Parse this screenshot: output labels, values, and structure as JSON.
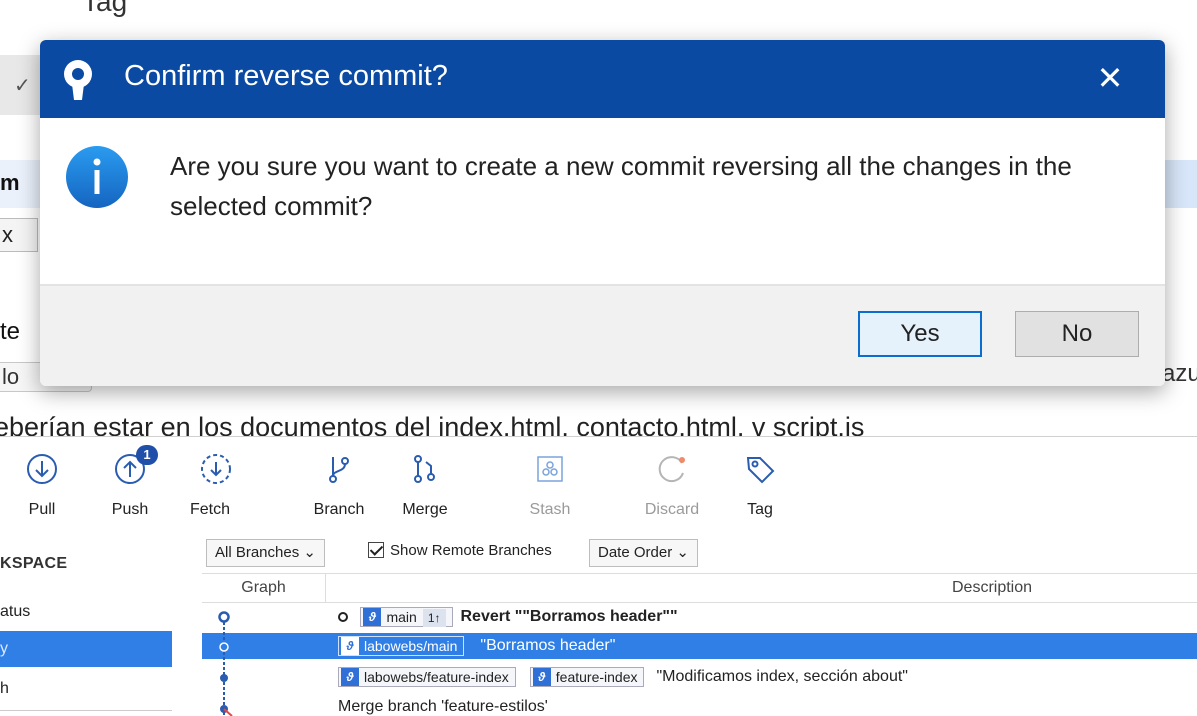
{
  "background": {
    "top_tag": "Tag",
    "left_fragments": [
      "m",
      "x",
      "te",
      "lo"
    ],
    "right_fragment": "azu",
    "desc_line": "eberían estar en los documentos del index.html. contacto.html. v script.is"
  },
  "toolbar": {
    "buttons": [
      {
        "label": "Pull",
        "icon": "pull-icon",
        "disabled": false
      },
      {
        "label": "Push",
        "icon": "push-icon",
        "disabled": false,
        "badge": "1"
      },
      {
        "label": "Fetch",
        "icon": "fetch-icon",
        "disabled": false
      },
      {
        "label": "Branch",
        "icon": "branch-icon",
        "disabled": false
      },
      {
        "label": "Merge",
        "icon": "merge-icon",
        "disabled": false
      },
      {
        "label": "Stash",
        "icon": "stash-icon",
        "disabled": true
      },
      {
        "label": "Discard",
        "icon": "discard-icon",
        "disabled": true
      },
      {
        "label": "Tag",
        "icon": "tag-icon",
        "disabled": false
      }
    ]
  },
  "sidebar": {
    "heading": "KSPACE",
    "items": [
      {
        "label": "atus",
        "active": false
      },
      {
        "label": "y",
        "active": true
      },
      {
        "label": "h",
        "active": false
      }
    ]
  },
  "history": {
    "branches_filter": "All Branches",
    "show_remote_label": "Show Remote Branches",
    "show_remote_checked": true,
    "order": "Date Order",
    "columns": {
      "graph": "Graph",
      "description": "Description"
    },
    "rows": [
      {
        "tags": [
          {
            "name": "main",
            "count": "1↑"
          }
        ],
        "message": "Revert \"\"Borramos header\"\"",
        "bold": true,
        "head": true,
        "selected": false
      },
      {
        "tags": [
          {
            "name": "labowebs/main"
          }
        ],
        "message": "\"Borramos header\"",
        "bold": false,
        "head": false,
        "selected": true
      },
      {
        "tags": [
          {
            "name": "labowebs/feature-index"
          },
          {
            "name": "feature-index"
          }
        ],
        "message": "\"Modificamos index, sección about\"",
        "bold": false,
        "head": false,
        "selected": false
      },
      {
        "tags": [],
        "message": "Merge branch 'feature-estilos'",
        "bold": false,
        "head": false,
        "selected": false
      }
    ]
  },
  "dialog": {
    "title": "Confirm reverse commit?",
    "message": "Are you sure you want to create a new commit reversing all the changes in the selected commit?",
    "yes_label": "Yes",
    "no_label": "No",
    "accent": "#0b4aa3",
    "info_color": "#1e88e5"
  }
}
